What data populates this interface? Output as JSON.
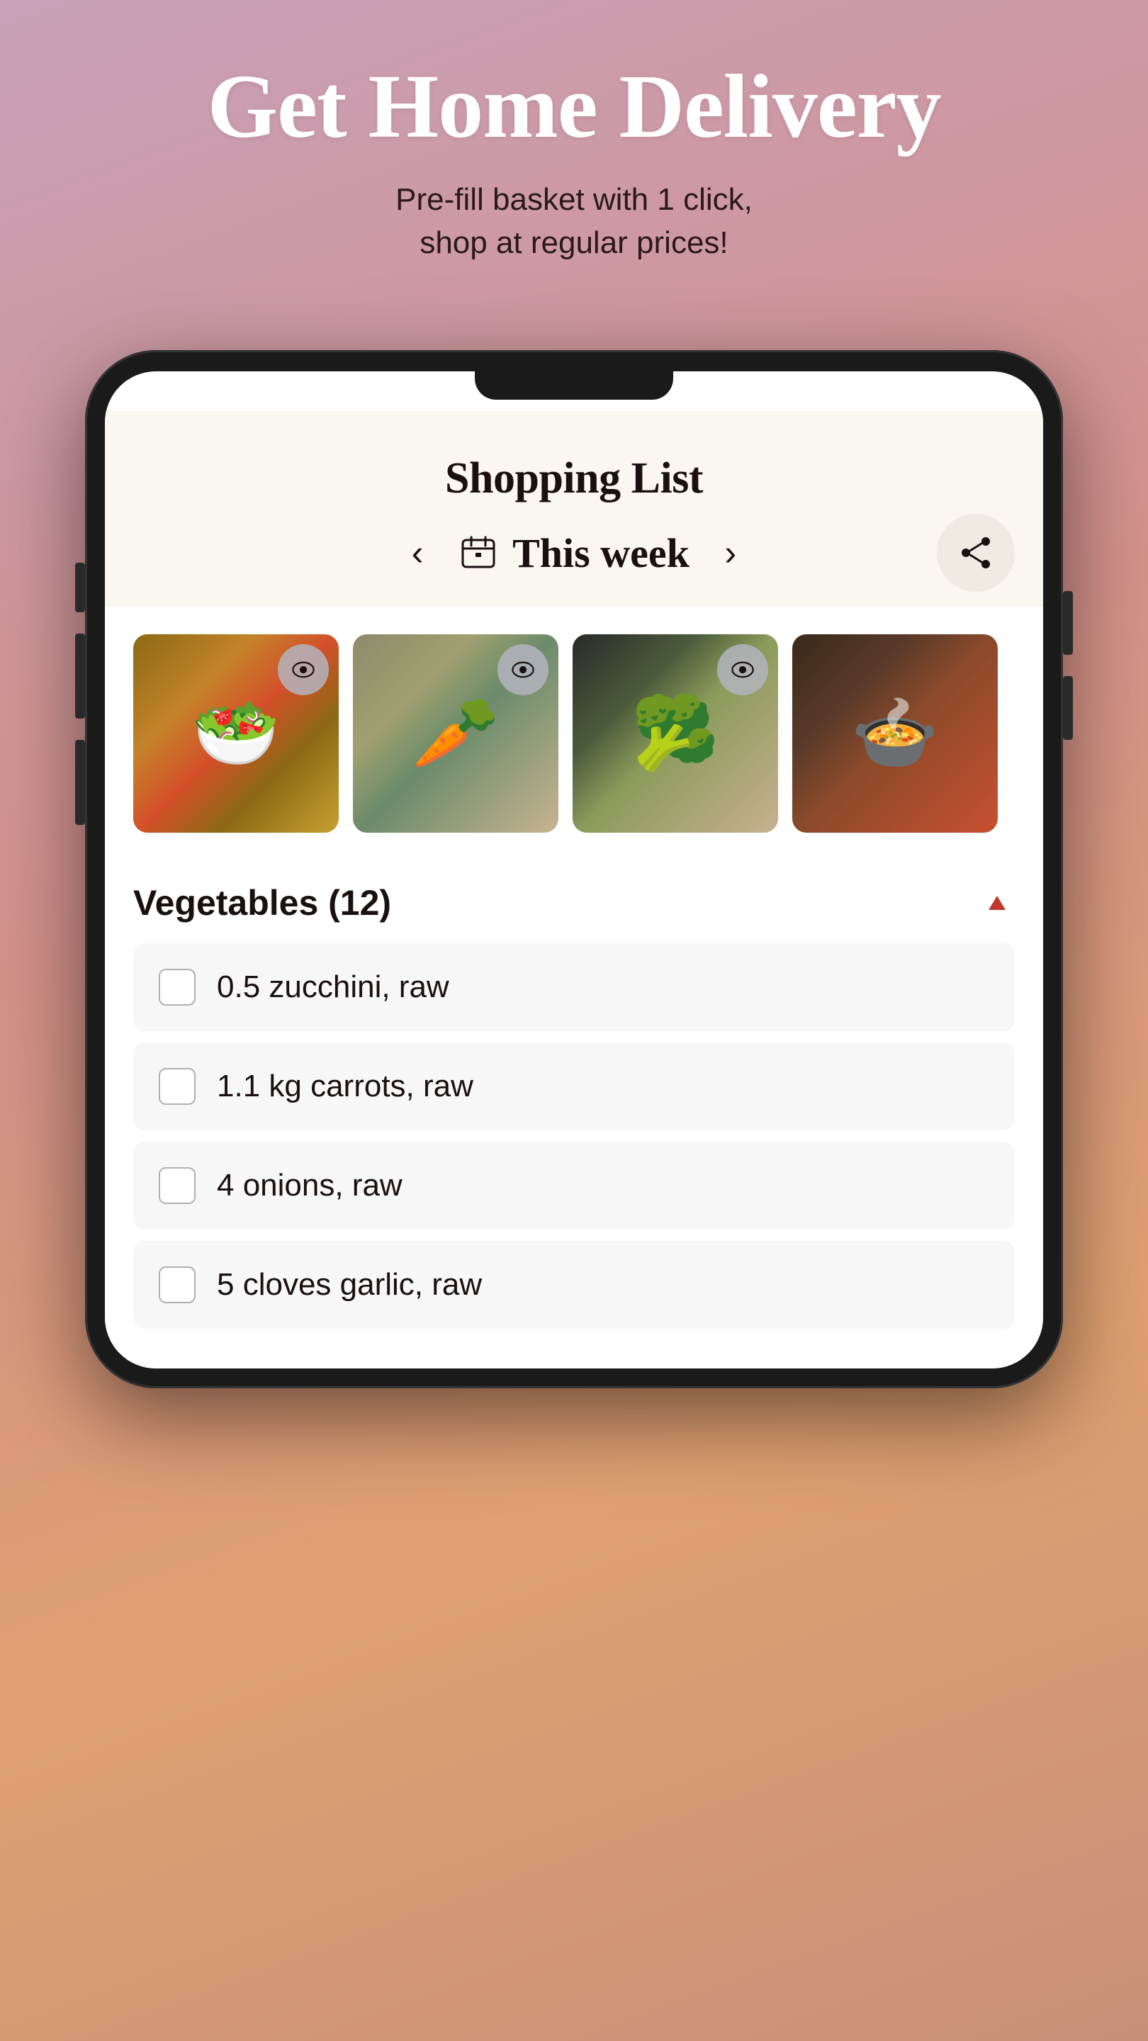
{
  "hero": {
    "title": "Get Home Delivery",
    "subtitle_line1": "Pre-fill basket with 1 click,",
    "subtitle_line2": "shop at regular prices!"
  },
  "app": {
    "screen_title": "Shopping List",
    "week_label": "This week",
    "nav_prev": "‹",
    "nav_next": "›",
    "share_icon": "share",
    "calendar_icon": "calendar",
    "eye_icon": "eye"
  },
  "recipes": [
    {
      "id": 1,
      "alt": "Veggie skewers recipe"
    },
    {
      "id": 2,
      "alt": "Carrot tart recipe"
    },
    {
      "id": 3,
      "alt": "Roasted vegetables recipe"
    },
    {
      "id": 4,
      "alt": "Soup recipe"
    }
  ],
  "shopping_list": {
    "category": "Vegetables (12)",
    "items": [
      {
        "id": 1,
        "text": "0.5 zucchini, raw",
        "checked": false
      },
      {
        "id": 2,
        "text": "1.1 kg carrots, raw",
        "checked": false
      },
      {
        "id": 3,
        "text": "4 onions, raw",
        "checked": false
      },
      {
        "id": 4,
        "text": "5 cloves garlic, raw",
        "checked": false
      }
    ]
  },
  "colors": {
    "accent_red": "#c0392b",
    "bg_gradient_start": "#c8a0b8",
    "bg_gradient_end": "#e0a070",
    "screen_bg": "#faf6f0",
    "text_dark": "#1a1010"
  }
}
